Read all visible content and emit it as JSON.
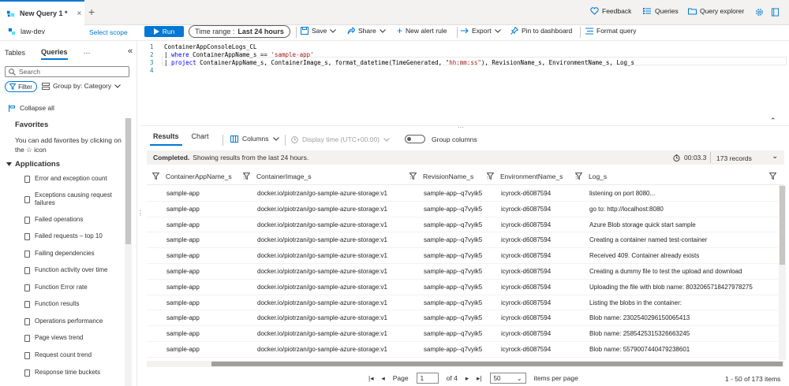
{
  "tabs": {
    "active": "New Query 1 *",
    "close": "×",
    "add": "+"
  },
  "top_links": {
    "feedback": "Feedback",
    "queries": "Queries",
    "query_explorer": "Query explorer"
  },
  "scope": {
    "name": "law-dev",
    "select": "Select scope"
  },
  "toolbar": {
    "run": "Run",
    "time_range_label": "Time range :",
    "time_range_value": "Last 24 hours",
    "save": "Save",
    "share": "Share",
    "new_alert": "New alert rule",
    "export": "Export",
    "pin": "Pin to dashboard",
    "format": "Format query"
  },
  "left_panel": {
    "tabs": [
      "Tables",
      "Queries",
      "···"
    ],
    "search_placeholder": "Search",
    "filter": "Filter",
    "group_by": "Group by: Category",
    "collapse_all": "Collapse all",
    "favorites_title": "Favorites",
    "favorites_text": "You can add favorites by clicking on the ☆ icon",
    "applications_title": "Applications",
    "queries": [
      "Error and exception count",
      "Exceptions causing request failures",
      "Failed operations",
      "Failed requests – top 10",
      "Failing dependencies",
      "Function activity over time",
      "Function Error rate",
      "Function results",
      "Operations performance",
      "Page views trend",
      "Request count trend",
      "Response time buckets"
    ]
  },
  "editor": {
    "line_numbers": [
      "1",
      "2",
      "3",
      "4"
    ],
    "line1": "ContainerAppConsoleLogs_CL",
    "line2_pipe": "| ",
    "line2_kw": "where",
    "line2_mid": " ContainerAppName_s == ",
    "line2_str": "'sample-app'",
    "line3_pipe": "| ",
    "line3_kw": "project",
    "line3_mid": " ContainerAppName_s, ContainerImage_s, format_datetime(TimeGenerated, ",
    "line3_str": "\"hh:mm:ss\"",
    "line3_end": "), RevisionName_s, EnvironmentName_s, Log_s"
  },
  "results": {
    "tabs": [
      "Results",
      "Chart"
    ],
    "columns": "Columns",
    "display_time": "Display time (UTC+00:00)",
    "group_columns": "Group columns",
    "status_bold": "Completed.",
    "status_text": "Showing results from the last 24 hours.",
    "elapsed": "00:03.3",
    "records": "173 records",
    "headers": [
      "ContainerAppName_s",
      "ContainerImage_s",
      "RevisionName_s",
      "EnvironmentName_s",
      "Log_s"
    ],
    "rows": [
      [
        "sample-app",
        "docker.io/piotrzan/go-sample-azure-storage:v1",
        "sample-app--q7vyik5",
        "icyrock-d6087594",
        "listening on port 8080..."
      ],
      [
        "sample-app",
        "docker.io/piotrzan/go-sample-azure-storage:v1",
        "sample-app--q7vyik5",
        "icyrock-d6087594",
        "go to: http://localhost:8080"
      ],
      [
        "sample-app",
        "docker.io/piotrzan/go-sample-azure-storage:v1",
        "sample-app--q7vyik5",
        "icyrock-d6087594",
        "Azure Blob storage quick start sample"
      ],
      [
        "sample-app",
        "docker.io/piotrzan/go-sample-azure-storage:v1",
        "sample-app--q7vyik5",
        "icyrock-d6087594",
        "Creating a container named test-container"
      ],
      [
        "sample-app",
        "docker.io/piotrzan/go-sample-azure-storage:v1",
        "sample-app--q7vyik5",
        "icyrock-d6087594",
        "Received 409. Container already exists"
      ],
      [
        "sample-app",
        "docker.io/piotrzan/go-sample-azure-storage:v1",
        "sample-app--q7vyik5",
        "icyrock-d6087594",
        "Creating a dummy file to test the upload and download"
      ],
      [
        "sample-app",
        "docker.io/piotrzan/go-sample-azure-storage:v1",
        "sample-app--q7vyik5",
        "icyrock-d6087594",
        "Uploading the file with blob name: 8032065718427978275"
      ],
      [
        "sample-app",
        "docker.io/piotrzan/go-sample-azure-storage:v1",
        "sample-app--q7vyik5",
        "icyrock-d6087594",
        "Listing the blobs in the container:"
      ],
      [
        "sample-app",
        "docker.io/piotrzan/go-sample-azure-storage:v1",
        "sample-app--q7vyik5",
        "icyrock-d6087594",
        "Blob name: 2302540296150065413"
      ],
      [
        "sample-app",
        "docker.io/piotrzan/go-sample-azure-storage:v1",
        "sample-app--q7vyik5",
        "icyrock-d6087594",
        "Blob name: 2585425315326663245"
      ],
      [
        "sample-app",
        "docker.io/piotrzan/go-sample-azure-storage:v1",
        "sample-app--q7vyik5",
        "icyrock-d6087594",
        "Blob name: 5579007440479238601"
      ]
    ]
  },
  "paging": {
    "page_label": "Page",
    "page_value": "1",
    "of_pages": "of 4",
    "per_page": "50",
    "per_page_label": "items per page",
    "range": "1 - 50 of 173 items"
  },
  "colors": {
    "accent": "#0078d4"
  }
}
